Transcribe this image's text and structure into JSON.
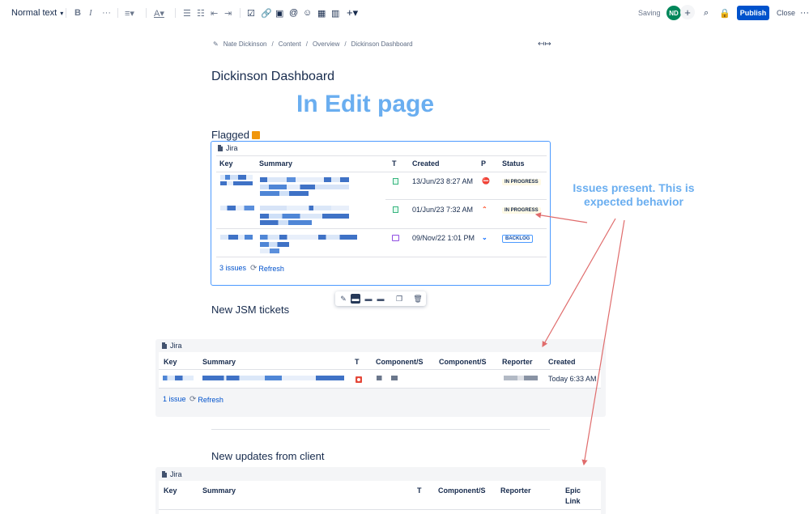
{
  "toolbar": {
    "text_style": "Normal text",
    "saving": "Saving",
    "avatar_initials": "ND",
    "publish": "Publish",
    "close": "Close"
  },
  "breadcrumb": [
    "Nate Dickinson",
    "Content",
    "Overview",
    "Dickinson Dashboard"
  ],
  "page_title": "Dickinson Dashboard",
  "annotation_title": "In Edit page",
  "annotation_note": "Issues present. This is expected behavior",
  "sections": {
    "flagged": {
      "heading": "Flagged",
      "macro_label": "Jira",
      "columns": [
        "Key",
        "Summary",
        "T",
        "Created",
        "P",
        "Status"
      ],
      "rows": [
        {
          "created": "13/Jun/23 8:27 AM",
          "status": "IN PROGRESS",
          "type": "story-icon",
          "priority": "blocker-icon"
        },
        {
          "created": "01/Jun/23 7:32 AM",
          "status": "IN PROGRESS",
          "type": "story-icon",
          "priority": "highest-icon"
        },
        {
          "created": "09/Nov/22 1:01 PM",
          "status": "BACKLOG",
          "type": "gift-icon",
          "priority": "lowest-icon"
        }
      ],
      "count": "3 issues",
      "refresh": "Refresh"
    },
    "jsm": {
      "heading": "New JSM tickets",
      "macro_label": "Jira",
      "columns": [
        "Key",
        "Summary",
        "T",
        "Component/S",
        "Component/S",
        "Reporter",
        "Created"
      ],
      "rows": [
        {
          "created": "Today 6:33 AM"
        }
      ],
      "count": "1 issue",
      "refresh": "Refresh"
    },
    "client": {
      "heading": "New updates from client",
      "macro_label": "Jira",
      "columns": [
        "Key",
        "Summary",
        "T",
        "Component/S",
        "Reporter",
        "Epic",
        "Link"
      ]
    }
  }
}
